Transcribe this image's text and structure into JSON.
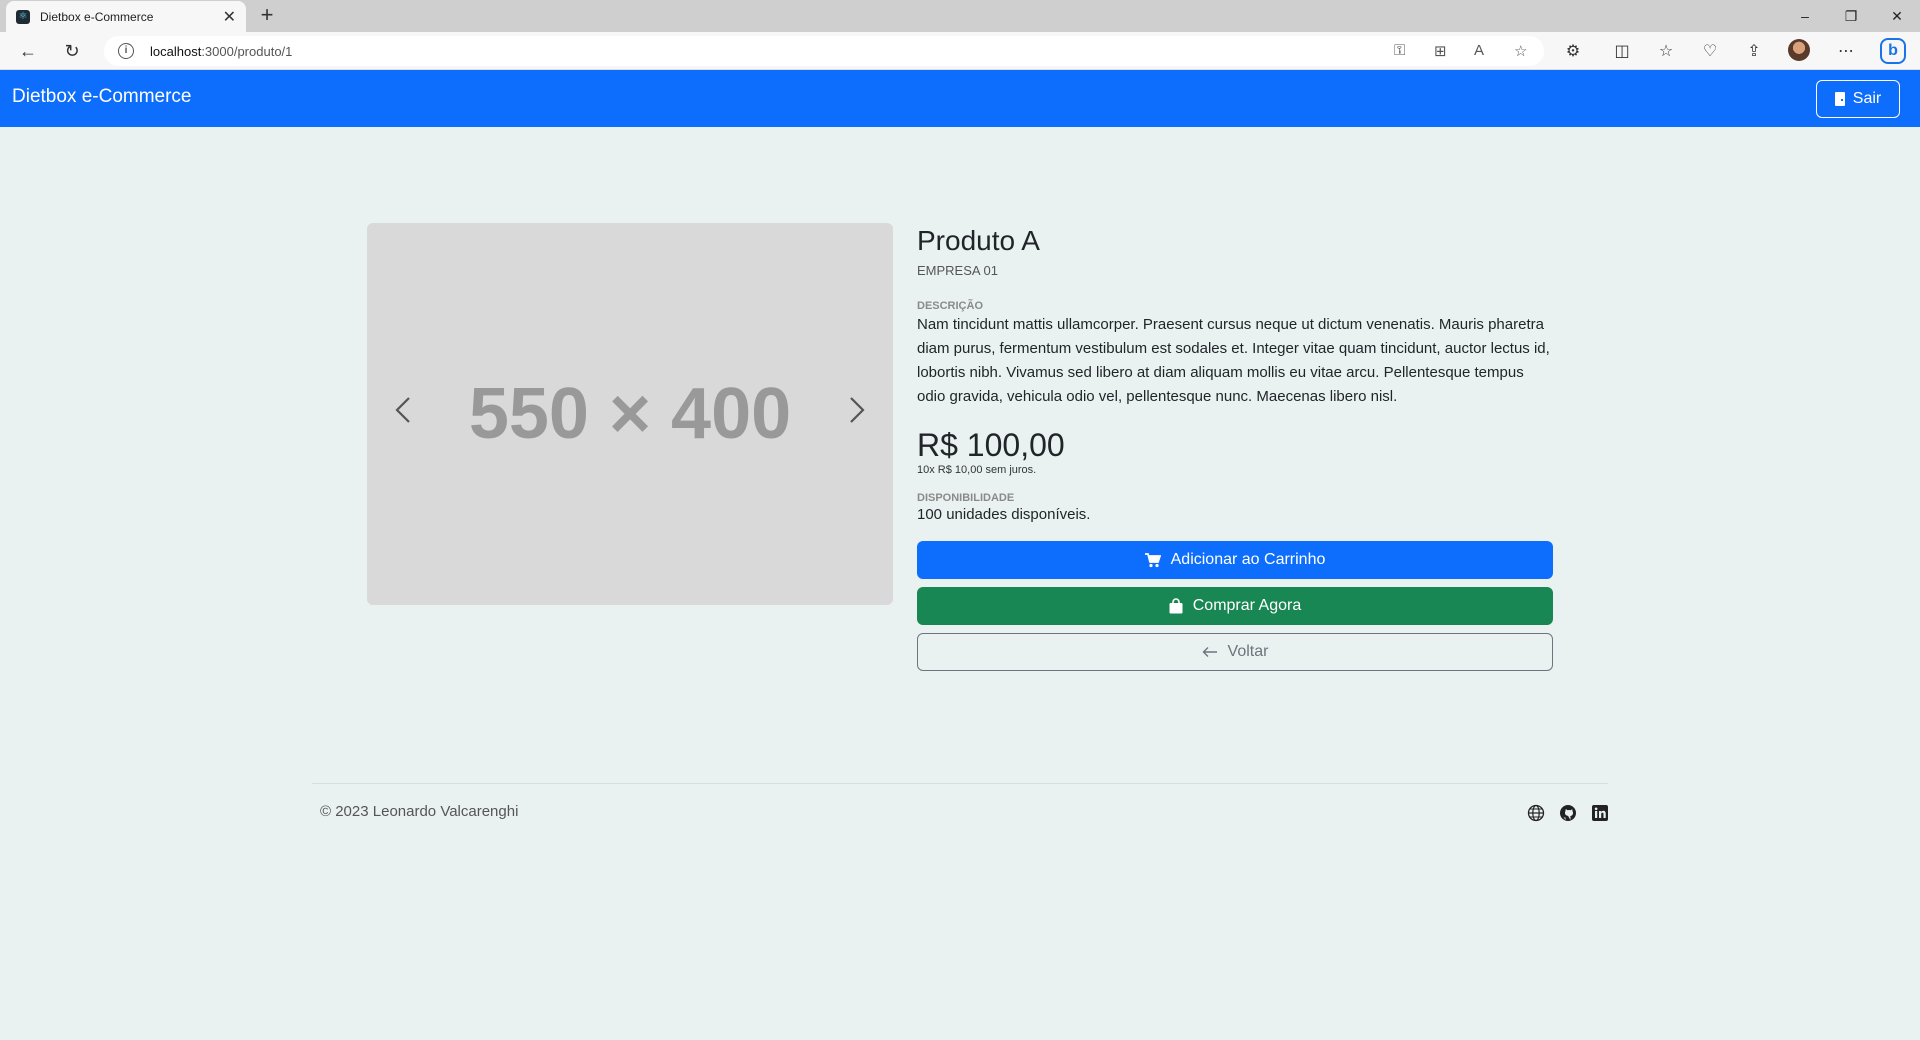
{
  "browser": {
    "tab_title": "Dietbox e-Commerce",
    "url_host": "localhost",
    "url_path": ":3000/produto/1",
    "new_tab": "+",
    "minimize": "–",
    "restore": "❐",
    "close": "✕",
    "tab_close": "✕"
  },
  "navbar": {
    "brand": "Dietbox e-Commerce",
    "logout_label": "Sair"
  },
  "carousel": {
    "placeholder_text": "550 × 400"
  },
  "product": {
    "name": "Produto A",
    "company": "EMPRESA 01",
    "description_label": "DESCRIÇÃO",
    "description": "Nam tincidunt mattis ullamcorper. Praesent cursus neque ut dictum venenatis. Mauris pharetra diam purus, fermentum vestibulum est sodales et. Integer vitae quam tincidunt, auctor lectus id, lobortis nibh. Vivamus sed libero at diam aliquam mollis eu vitae arcu. Pellentesque tempus odio gravida, vehicula odio vel, pellentesque nunc. Maecenas libero nisl.",
    "price": "R$ 100,00",
    "installments": "10x R$ 10,00 sem juros.",
    "availability_label": "DISPONIBILIDADE",
    "availability": "100 unidades disponíveis."
  },
  "actions": {
    "add_to_cart": "Adicionar ao Carrinho",
    "buy_now": "Comprar Agora",
    "back": "Voltar"
  },
  "footer": {
    "copyright": "© 2023 Leonardo Valcarenghi"
  },
  "colors": {
    "primary": "#0d6efd",
    "success": "#198754",
    "background": "#eaf2f1"
  },
  "icons": [
    "back-arrow-icon",
    "reload-icon",
    "info-icon",
    "cart-icon",
    "bag-icon",
    "arrow-left-icon",
    "globe-icon",
    "github-icon",
    "linkedin-icon",
    "door-icon"
  ]
}
